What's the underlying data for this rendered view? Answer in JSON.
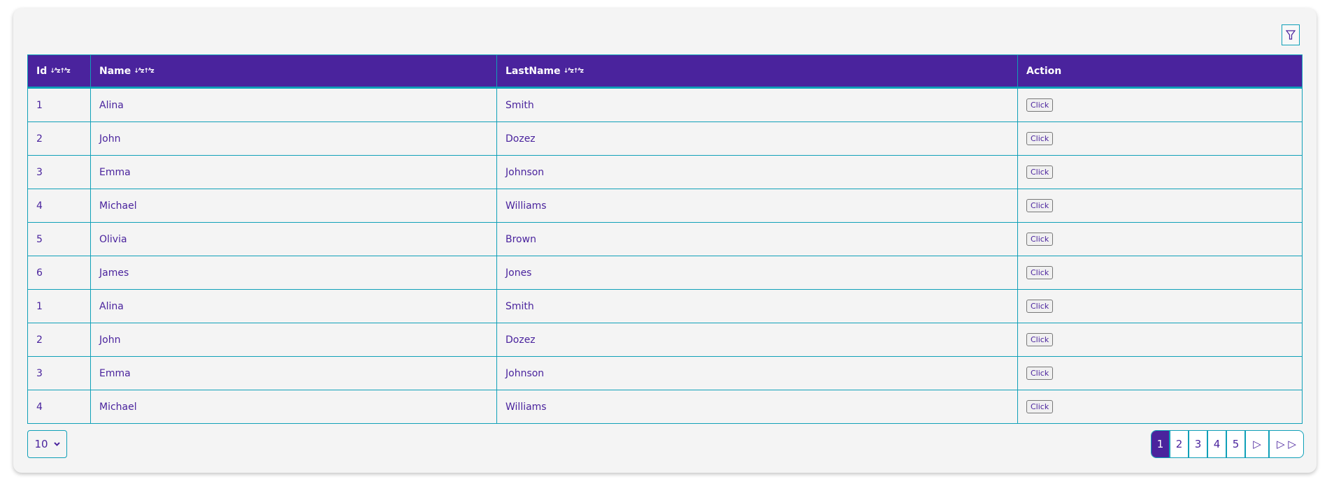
{
  "colors": {
    "primary": "#4a239d",
    "border": "#0fa0b8",
    "background": "#f4f4f4"
  },
  "toolbar": {
    "filter_icon": "filter-funnel-icon"
  },
  "table": {
    "columns": [
      {
        "label": "Id",
        "sort_icons": "↓ᴬz↑ᴬz"
      },
      {
        "label": "Name",
        "sort_icons": "↓ᴬz↑ᴬz"
      },
      {
        "label": "LastName",
        "sort_icons": "↓ᴬz↑ᴬz"
      },
      {
        "label": "Action"
      }
    ],
    "rows": [
      {
        "id": "1",
        "name": "Alina",
        "last": "Smith",
        "action": "Click"
      },
      {
        "id": "2",
        "name": "John",
        "last": "Dozez",
        "action": "Click"
      },
      {
        "id": "3",
        "name": "Emma",
        "last": "Johnson",
        "action": "Click"
      },
      {
        "id": "4",
        "name": "Michael",
        "last": "Williams",
        "action": "Click"
      },
      {
        "id": "5",
        "name": "Olivia",
        "last": "Brown",
        "action": "Click"
      },
      {
        "id": "6",
        "name": "James",
        "last": "Jones",
        "action": "Click"
      },
      {
        "id": "1",
        "name": "Alina",
        "last": "Smith",
        "action": "Click"
      },
      {
        "id": "2",
        "name": "John",
        "last": "Dozez",
        "action": "Click"
      },
      {
        "id": "3",
        "name": "Emma",
        "last": "Johnson",
        "action": "Click"
      },
      {
        "id": "4",
        "name": "Michael",
        "last": "Williams",
        "action": "Click"
      }
    ]
  },
  "page_size": {
    "selected": "10"
  },
  "pagination": {
    "pages": [
      "1",
      "2",
      "3",
      "4",
      "5"
    ],
    "current": "1",
    "next": "▷",
    "last": "▷ ▷"
  }
}
